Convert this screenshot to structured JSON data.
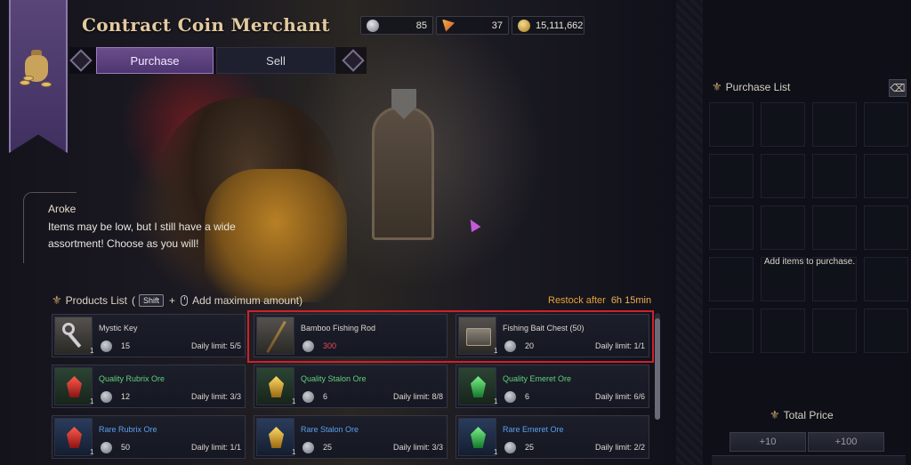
{
  "window": {
    "title": "Contract Coin Merchant"
  },
  "currencies": [
    {
      "icon": "silver-coin-icon",
      "value": "85",
      "color": "#b8bcc6"
    },
    {
      "icon": "pizza-slice-icon",
      "value": "37",
      "color": "#d2502e"
    },
    {
      "icon": "gold-coin-icon",
      "value": "15,111,662",
      "color": "#d4a640"
    }
  ],
  "tabs": {
    "purchase": "Purchase",
    "sell": "Sell"
  },
  "dialogue": {
    "speaker": "Aroke",
    "text": "Items may be low, but I still have a wide assortment! Choose as you will!"
  },
  "products_header": {
    "title": "Products List",
    "open_paren": "(",
    "shift_key": "Shift",
    "plus": "+",
    "hint": "Add maximum amount)"
  },
  "restock": {
    "label": "Restock after",
    "value": "6h 15min"
  },
  "products": [
    {
      "name": "Mystic Key",
      "tier": "normal",
      "icon": "key-icon",
      "qty": "1",
      "price": "15",
      "limit": "Daily limit: 5/5",
      "price_color": "normal"
    },
    {
      "name": "Bamboo Fishing Rod",
      "tier": "normal",
      "icon": "fishing-rod-icon",
      "qty": "",
      "price": "300",
      "limit": "",
      "price_color": "red"
    },
    {
      "name": "Fishing Bait Chest (50)",
      "tier": "normal",
      "icon": "chest-icon",
      "qty": "1",
      "price": "20",
      "limit": "Daily limit: 1/1",
      "price_color": "normal"
    },
    {
      "name": "Quality Rubrix Ore",
      "tier": "quality",
      "icon": "red-ore-icon",
      "qty": "1",
      "price": "12",
      "limit": "Daily limit: 3/3",
      "price_color": "normal"
    },
    {
      "name": "Quality Stalon Ore",
      "tier": "quality",
      "icon": "yellow-ore-icon",
      "qty": "1",
      "price": "6",
      "limit": "Daily limit: 8/8",
      "price_color": "normal"
    },
    {
      "name": "Quality Emeret Ore",
      "tier": "quality",
      "icon": "green-ore-icon",
      "qty": "1",
      "price": "6",
      "limit": "Daily limit: 6/6",
      "price_color": "normal"
    },
    {
      "name": "Rare Rubrix Ore",
      "tier": "rare",
      "icon": "red-ore-icon",
      "qty": "1",
      "price": "50",
      "limit": "Daily limit: 1/1",
      "price_color": "normal"
    },
    {
      "name": "Rare Stalon Ore",
      "tier": "rare",
      "icon": "yellow-ore-icon",
      "qty": "1",
      "price": "25",
      "limit": "Daily limit: 3/3",
      "price_color": "normal"
    },
    {
      "name": "Rare Emeret Ore",
      "tier": "rare",
      "icon": "green-ore-icon",
      "qty": "1",
      "price": "25",
      "limit": "Daily limit: 2/2",
      "price_color": "normal"
    }
  ],
  "purchase_list": {
    "title": "Purchase List",
    "empty_message": "Add items to purchase.",
    "total_title": "Total Price",
    "plus10": "+10",
    "plus100": "+100"
  },
  "colors": {
    "accent_purple": "#6a4d8c",
    "quality_green": "#5fd27a",
    "rare_blue": "#5aa0ee",
    "restock_orange": "#e6a03a",
    "price_red": "#e54e5a",
    "highlight_red": "#d0202c"
  }
}
